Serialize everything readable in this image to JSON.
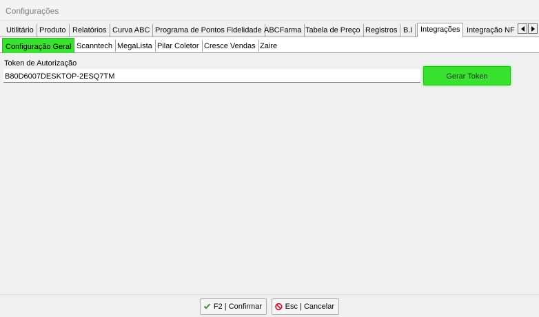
{
  "window": {
    "title": "Configurações"
  },
  "tabs_primary": {
    "items": [
      {
        "label": "Utilitário"
      },
      {
        "label": "Produto"
      },
      {
        "label": "Relatórios"
      },
      {
        "label": "Curva ABC"
      },
      {
        "label": "Programa de Pontos Fidelidade"
      },
      {
        "label": "ABCFarma"
      },
      {
        "label": "Tabela de Preço"
      },
      {
        "label": "Registros"
      },
      {
        "label": "B.I"
      },
      {
        "label": "Integrações"
      },
      {
        "label": "Integração NF"
      }
    ],
    "active": "Integrações",
    "scroll_left_icon": "arrow-left-icon",
    "scroll_right_icon": "arrow-right-icon"
  },
  "tabs_secondary": {
    "items": [
      {
        "label": "Configuração Geral"
      },
      {
        "label": "Scanntech"
      },
      {
        "label": "MegaLista"
      },
      {
        "label": "Pilar Coletor"
      },
      {
        "label": "Cresce Vendas"
      },
      {
        "label": "Zaire"
      }
    ],
    "active": "Configuração Geral",
    "active_color": "#39e22f"
  },
  "form": {
    "token_label": "Token de Autorização",
    "token_value": "B80D6007DESKTOP-2ESQ7TM",
    "generate_button": "Gerar Token",
    "generate_button_color": "#39e22f"
  },
  "footer": {
    "confirm_label": "F2 | Confirmar",
    "confirm_icon": "checkmark-icon",
    "cancel_label": "Esc | Cancelar",
    "cancel_icon": "no-entry-icon"
  }
}
